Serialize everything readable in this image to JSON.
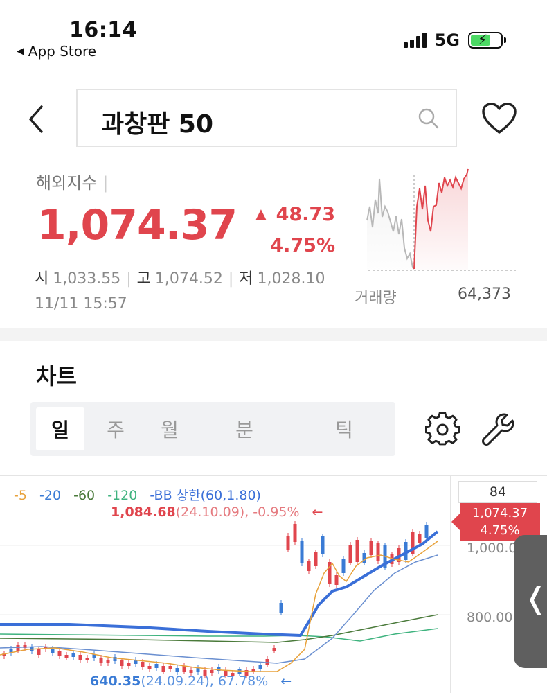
{
  "status_bar": {
    "time": "16:14",
    "back_app": "App Store",
    "network": "5G",
    "icons": [
      "signal-icon",
      "battery-charging-icon"
    ]
  },
  "header": {
    "search_text": "과창판 50",
    "icons": [
      "back-chevron-icon",
      "search-icon",
      "heart-icon"
    ]
  },
  "quote": {
    "category": "해외지수",
    "price": "1,074.37",
    "change": "48.73",
    "change_pct": "4.75%",
    "open_label": "시",
    "open_value": "1,033.55",
    "high_label": "고",
    "high_value": "1,074.52",
    "low_label": "저",
    "low_value": "1,028.10",
    "timestamp": "11/11 15:57",
    "volume_label": "거래량",
    "volume_value": "64,373",
    "up_color": "#e0454d"
  },
  "chart_section": {
    "heading": "차트",
    "tabs": [
      "일",
      "주",
      "월",
      "분",
      "틱"
    ],
    "active_tab": "일",
    "icons": [
      "gear-icon",
      "wrench-icon"
    ]
  },
  "chart": {
    "legend": [
      {
        "label": "5",
        "color": "#e8a23b"
      },
      {
        "label": "20",
        "color": "#3a7bd5"
      },
      {
        "label": "60",
        "color": "#4a7a3a"
      },
      {
        "label": "120",
        "color": "#3fb37f"
      },
      {
        "label": "BB 상한(60,1.80)",
        "color": "#3a6fd8"
      }
    ],
    "high_annotation": {
      "value": "1,084.68",
      "detail": "(24.10.09), -0.95%",
      "arrow": "←"
    },
    "low_annotation": {
      "value": "640.35",
      "detail": "(24.09.24), 67.78%",
      "arrow": "←"
    },
    "axis_top": "84",
    "current_price_tag": "1,074.37",
    "current_change_tag": "4.75%",
    "axis_labels": [
      "1,000.0",
      "800.00"
    ],
    "side_handle": "❬"
  }
}
